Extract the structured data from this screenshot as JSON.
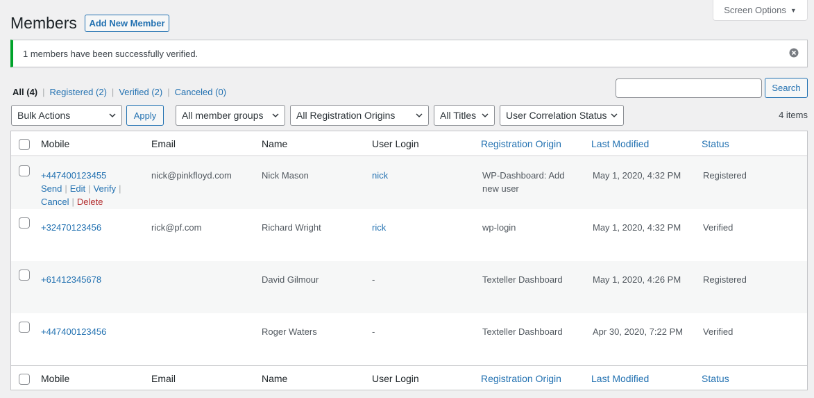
{
  "screen_options": {
    "label": "Screen Options"
  },
  "page": {
    "title": "Members",
    "add_new_label": "Add New Member"
  },
  "notice": {
    "message": "1 members have been successfully verified."
  },
  "filters_views": {
    "all": "All",
    "all_count": "(4)",
    "registered": "Registered",
    "registered_count": "(2)",
    "verified": "Verified",
    "verified_count": "(2)",
    "canceled": "Canceled",
    "canceled_count": "(0)"
  },
  "search": {
    "value": "",
    "button_label": "Search"
  },
  "bulk": {
    "selected": "Bulk Actions",
    "apply_label": "Apply"
  },
  "dropdowns": {
    "groups": "All member groups",
    "origins": "All Registration Origins",
    "titles": "All Titles",
    "correlation": "User Correlation Status"
  },
  "items_count": "4 items",
  "columns": {
    "mobile": "Mobile",
    "email": "Email",
    "name": "Name",
    "user_login": "User Login",
    "registration_origin": "Registration Origin",
    "last_modified": "Last Modified",
    "status": "Status"
  },
  "row_actions": {
    "send": "Send",
    "edit": "Edit",
    "verify": "Verify",
    "cancel": "Cancel",
    "delete": "Delete"
  },
  "rows": [
    {
      "mobile": "+447400123455",
      "email": "nick@pinkfloyd.com",
      "name": "Nick Mason",
      "user_login": "nick",
      "origin_line1": "WP-Dashboard: Add",
      "origin_line2": "new user",
      "last_modified": "May 1, 2020, 4:32 PM",
      "status": "Registered"
    },
    {
      "mobile": "+32470123456",
      "email": "rick@pf.com",
      "name": "Richard Wright",
      "user_login": "rick",
      "origin_line1": "wp-login",
      "origin_line2": "",
      "last_modified": "May 1, 2020, 4:32 PM",
      "status": "Verified"
    },
    {
      "mobile": "+61412345678",
      "email": "",
      "name": "David Gilmour",
      "user_login": "-",
      "origin_line1": "Texteller Dashboard",
      "origin_line2": "",
      "last_modified": "May 1, 2020, 4:26 PM",
      "status": "Registered"
    },
    {
      "mobile": "+447400123456",
      "email": "",
      "name": "Roger Waters",
      "user_login": "-",
      "origin_line1": "Texteller Dashboard",
      "origin_line2": "",
      "last_modified": "Apr 30, 2020, 7:22 PM",
      "status": "Verified"
    }
  ],
  "colors": {
    "link": "#2271b1",
    "success": "#00a32a",
    "delete": "#b32d2e"
  }
}
